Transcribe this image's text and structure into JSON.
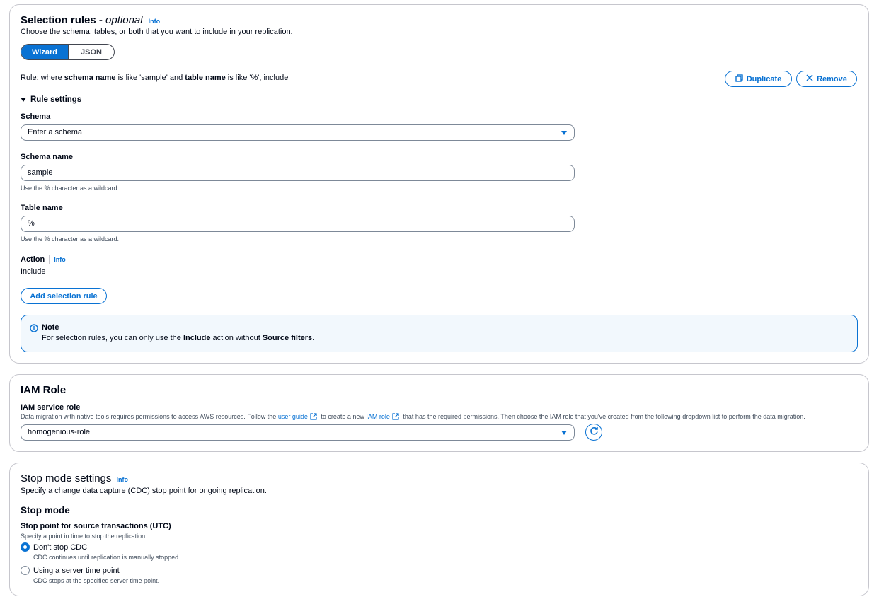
{
  "selection_rules": {
    "title": "Selection rules - ",
    "title_optional": "optional",
    "info": "Info",
    "description": "Choose the schema, tables, or both that you want to include in your replication.",
    "tabs": {
      "wizard": "Wizard",
      "json": "JSON"
    },
    "rule_summary": {
      "prefix": "Rule: where ",
      "schema_key": "schema name",
      "mid1": " is like 'sample' and ",
      "table_key": "table name",
      "suffix": " is like '%', include"
    },
    "duplicate_label": "Duplicate",
    "remove_label": "Remove",
    "rule_settings_label": "Rule settings",
    "schema": {
      "label": "Schema",
      "value": "Enter a schema"
    },
    "schema_name": {
      "label": "Schema name",
      "value": "sample",
      "hint": "Use the % character as a wildcard."
    },
    "table_name": {
      "label": "Table name",
      "value": "%",
      "hint": "Use the % character as a wildcard."
    },
    "action": {
      "label": "Action",
      "info": "Info",
      "value": "Include"
    },
    "add_rule_label": "Add selection rule",
    "note": {
      "title": "Note",
      "text_prefix": "For selection rules, you can only use the ",
      "bold1": "Include",
      "text_mid": " action without ",
      "bold2": "Source filters",
      "text_suffix": "."
    }
  },
  "iam_role": {
    "title": "IAM Role",
    "service_role_label": "IAM service role",
    "desc_prefix": "Data migration with native tools requires permissions to access AWS resources. Follow the ",
    "user_guide_link": "user guide",
    "desc_mid": " to create a new ",
    "iam_role_link": "IAM role",
    "desc_suffix": " that has the required permissions. Then choose the IAM role that you've created from the following dropdown list to perform the data migration.",
    "selected_role": "homogenious-role"
  },
  "stop_mode": {
    "title": "Stop mode settings",
    "info": "Info",
    "description": "Specify a change data capture (CDC) stop point for ongoing replication.",
    "subheading": "Stop mode",
    "field_label": "Stop point for source transactions (UTC)",
    "field_hint": "Specify a point in time to stop the replication.",
    "options": [
      {
        "label": "Don't stop CDC",
        "desc": "CDC continues until replication is manually stopped.",
        "selected": true
      },
      {
        "label": "Using a server time point",
        "desc": "CDC stops at the specified server time point.",
        "selected": false
      }
    ]
  },
  "colors": {
    "accent": "#0972d3",
    "border": "#c6c6cd",
    "note_bg": "#f2f8fd",
    "text": "#000716"
  }
}
